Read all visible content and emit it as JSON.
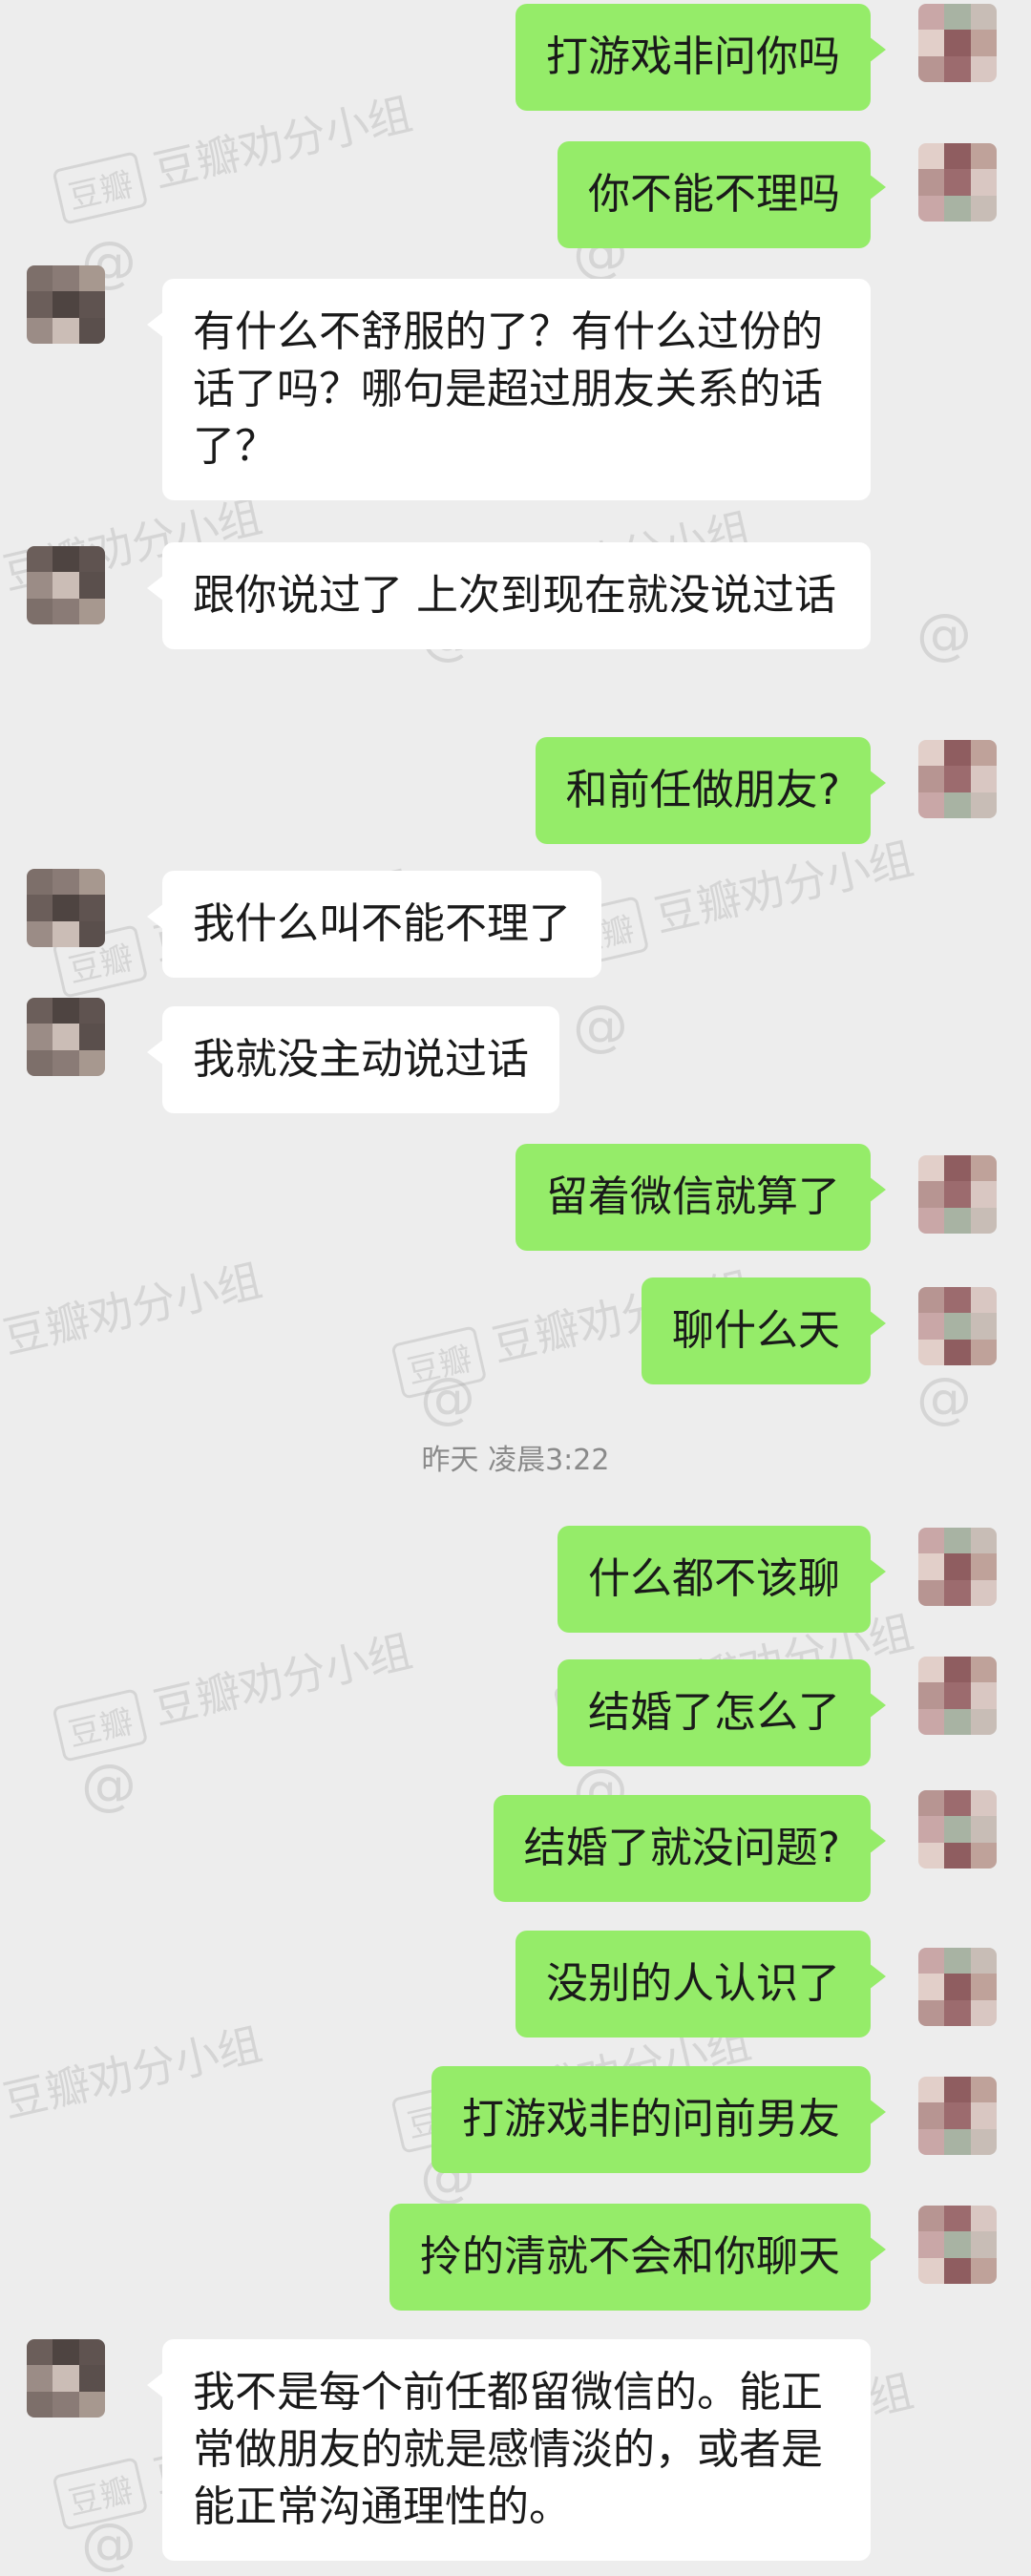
{
  "watermark": {
    "tag": "豆瓣",
    "text": "豆瓣劝分小组",
    "at": "@"
  },
  "colors": {
    "background": "#ededed",
    "me_bubble": "#95ec69",
    "other_bubble": "#ffffff"
  },
  "messages": [
    {
      "side": "me",
      "text": "打游戏非问你吗"
    },
    {
      "side": "me",
      "text": "你不能不理吗"
    },
    {
      "side": "other",
      "text": "有什么不舒服的了？有什么过份的话了吗？哪句是超过朋友关系的话了？"
    },
    {
      "side": "other",
      "text": "跟你说过了 上次到现在就没说过话"
    },
    {
      "side": "me",
      "text": "和前任做朋友?"
    },
    {
      "side": "other",
      "text": "我什么叫不能不理了"
    },
    {
      "side": "other",
      "text": "我就没主动说过话"
    },
    {
      "side": "me",
      "text": "留着微信就算了"
    },
    {
      "side": "me",
      "text": "聊什么天"
    },
    {
      "side": "time",
      "text": "昨天 凌晨3:22"
    },
    {
      "side": "me",
      "text": "什么都不该聊"
    },
    {
      "side": "me",
      "text": "结婚了怎么了"
    },
    {
      "side": "me",
      "text": "结婚了就没问题?"
    },
    {
      "side": "me",
      "text": "没别的人认识了"
    },
    {
      "side": "me",
      "text": "打游戏非的问前男友"
    },
    {
      "side": "me",
      "text": "拎的清就不会和你聊天"
    },
    {
      "side": "other",
      "text": "我不是每个前任都留微信的。能正常做朋友的就是感情淡的，或者是能正常沟通理性的。"
    }
  ]
}
